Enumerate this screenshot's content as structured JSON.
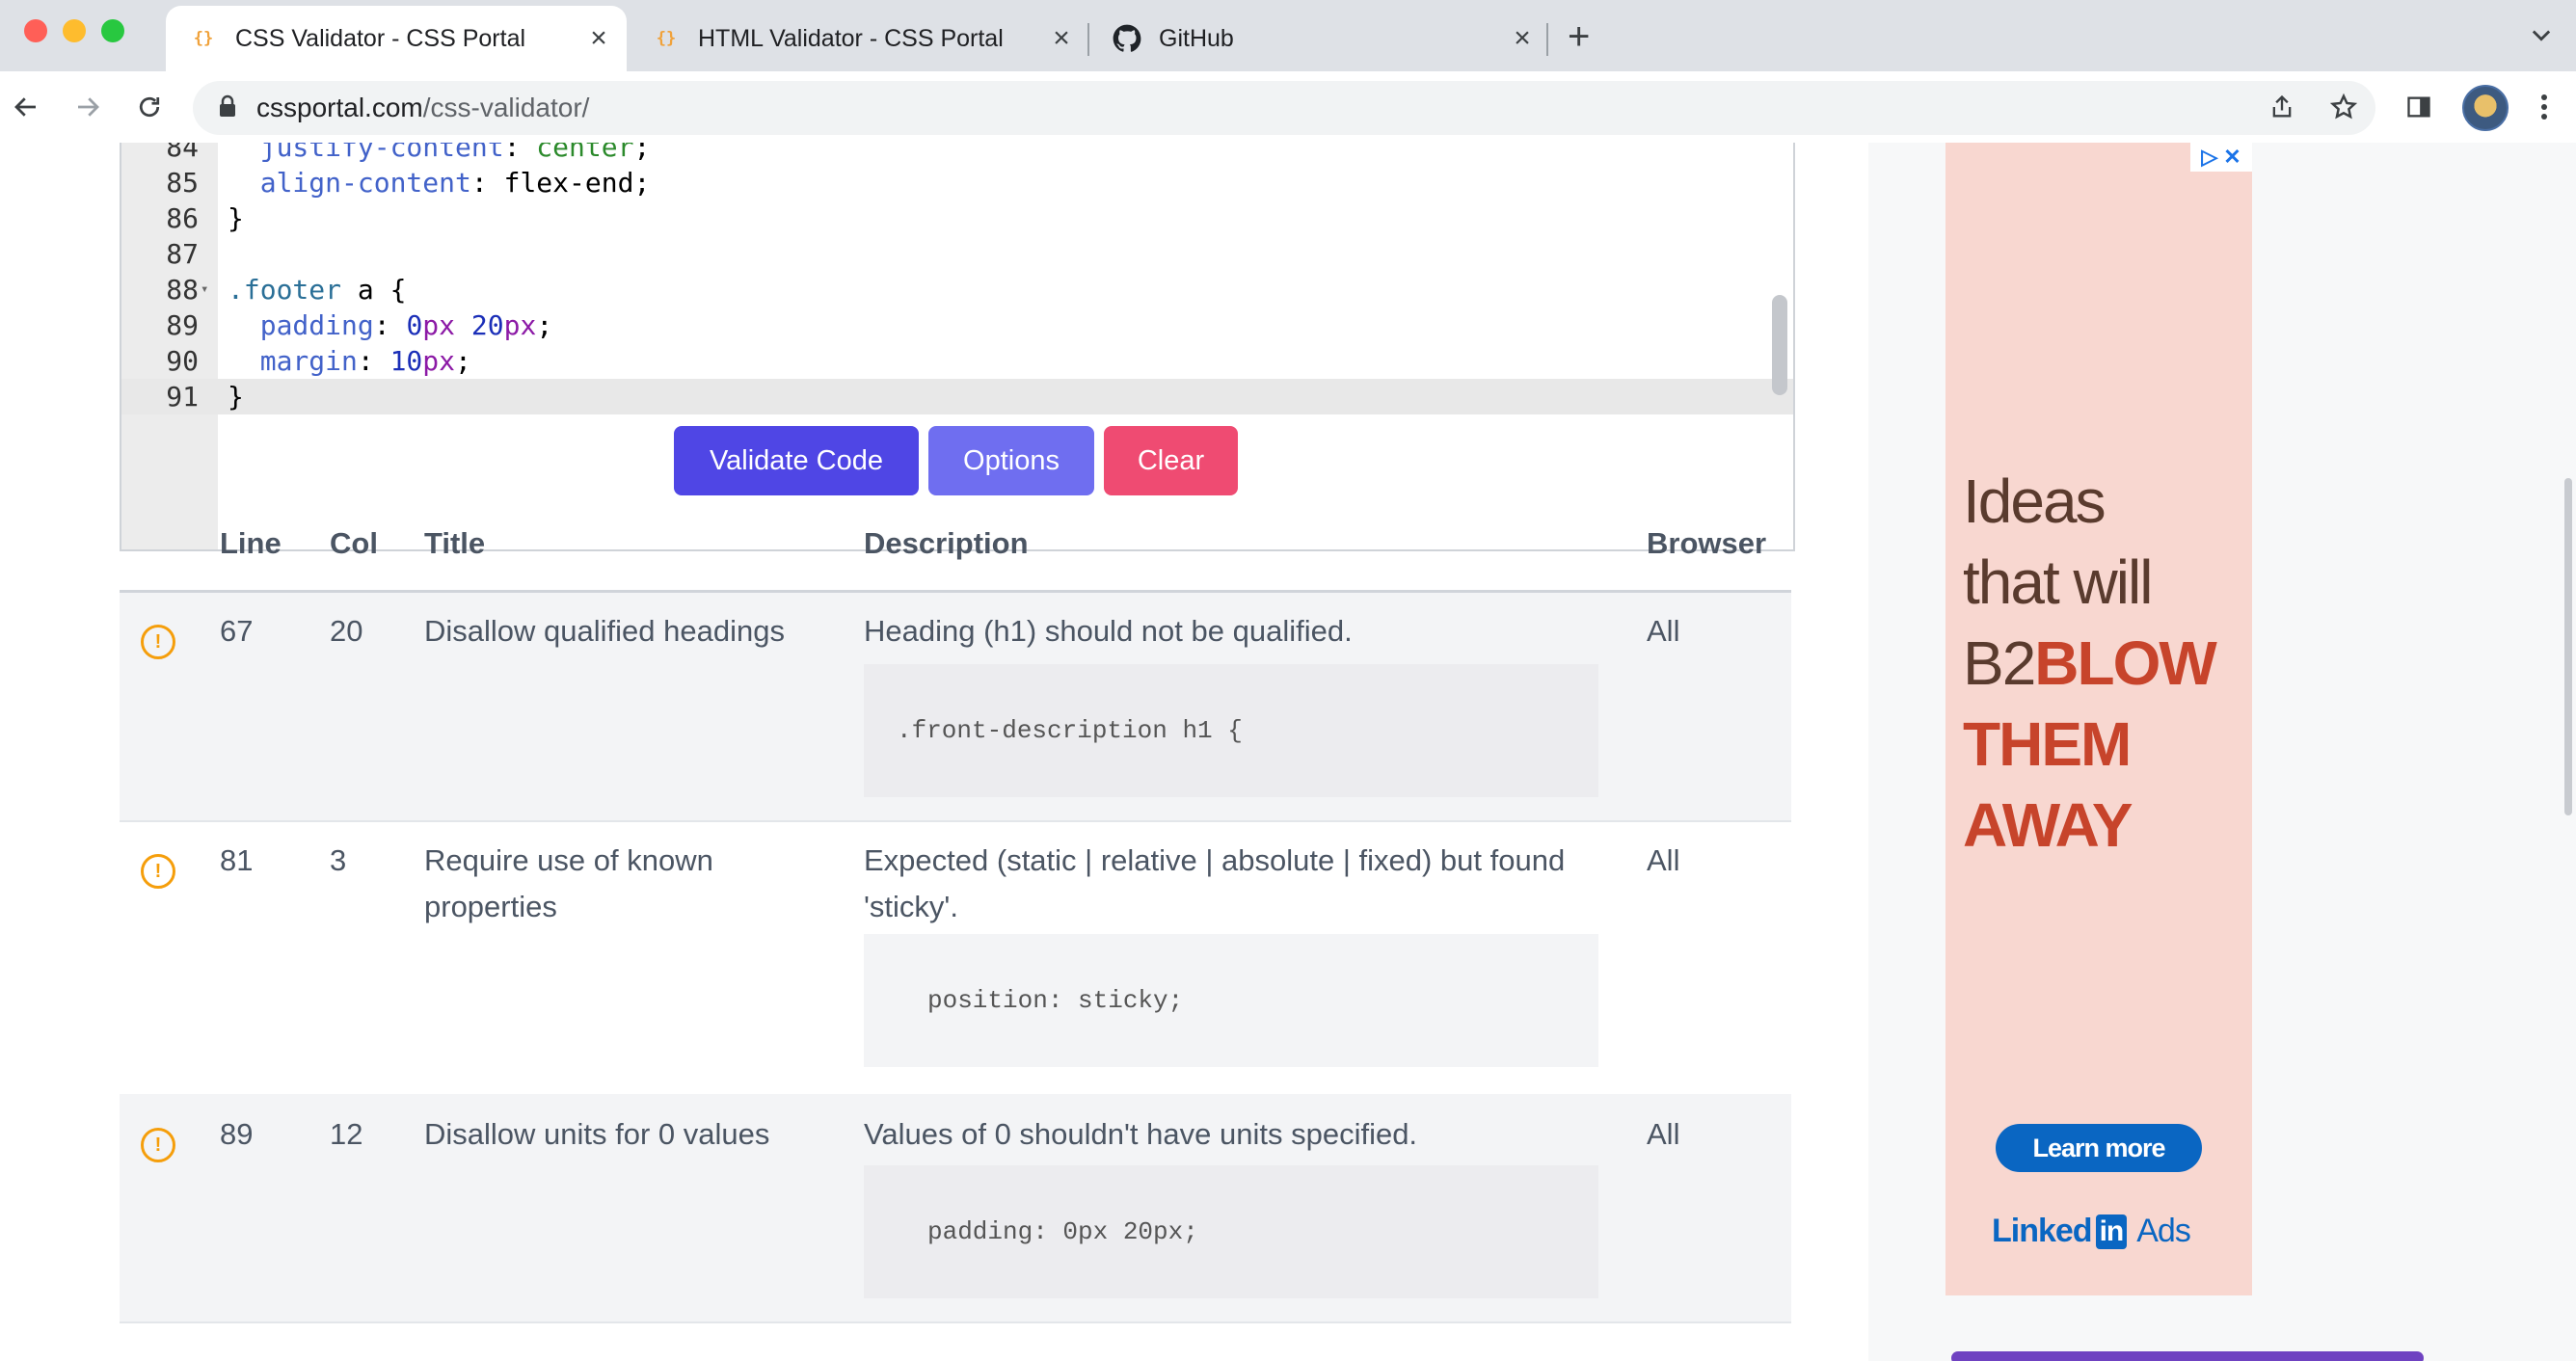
{
  "browser": {
    "tabs": [
      {
        "title": "CSS Validator - CSS Portal",
        "favicon": "css-portal-icon",
        "active": true
      },
      {
        "title": "HTML Validator - CSS Portal",
        "favicon": "css-portal-icon",
        "active": false
      },
      {
        "title": "GitHub",
        "favicon": "github-icon",
        "active": false
      }
    ],
    "url_host": "cssportal.com",
    "url_path": "/css-validator/"
  },
  "editor": {
    "lines": [
      {
        "num": "84",
        "text": "  justify-content: center;"
      },
      {
        "num": "85",
        "text": "  align-content: flex-end;"
      },
      {
        "num": "86",
        "text": "}"
      },
      {
        "num": "87",
        "text": ""
      },
      {
        "num": "88",
        "text": ".footer a {"
      },
      {
        "num": "89",
        "text": "  padding: 0px 20px;"
      },
      {
        "num": "90",
        "text": "  margin: 10px;"
      },
      {
        "num": "91",
        "text": "}"
      }
    ]
  },
  "buttons": {
    "validate": "Validate Code",
    "options": "Options",
    "clear": "Clear"
  },
  "results": {
    "headers": {
      "line": "Line",
      "col": "Col",
      "title": "Title",
      "description": "Description",
      "browser": "Browser"
    },
    "rows": [
      {
        "line": "67",
        "col": "20",
        "title": "Disallow qualified headings",
        "description": "Heading (h1) should not be qualified.",
        "snippet": ".front-description h1 {",
        "browser": "All"
      },
      {
        "line": "81",
        "col": "3",
        "title": "Require use of known properties",
        "description": "Expected (static | relative | absolute | fixed) but found 'sticky'.",
        "snippet": "position: sticky;",
        "browser": "All"
      },
      {
        "line": "89",
        "col": "12",
        "title": "Disallow units for 0 values",
        "description": "Values of 0 shouldn't have units specified.",
        "snippet": "padding: 0px 20px;",
        "browser": "All"
      }
    ]
  },
  "ad": {
    "headline": [
      "Ideas",
      "that will",
      "B2BLOW",
      "THEM",
      "AWAY"
    ],
    "cta": "Learn more",
    "brand_text": "Linked",
    "brand_in": "in",
    "brand_suffix": "Ads"
  },
  "colors": {
    "validate": "#4f46e5",
    "options": "#6f6ef0",
    "clear": "#ef4b72",
    "warning": "#f59e0b"
  }
}
